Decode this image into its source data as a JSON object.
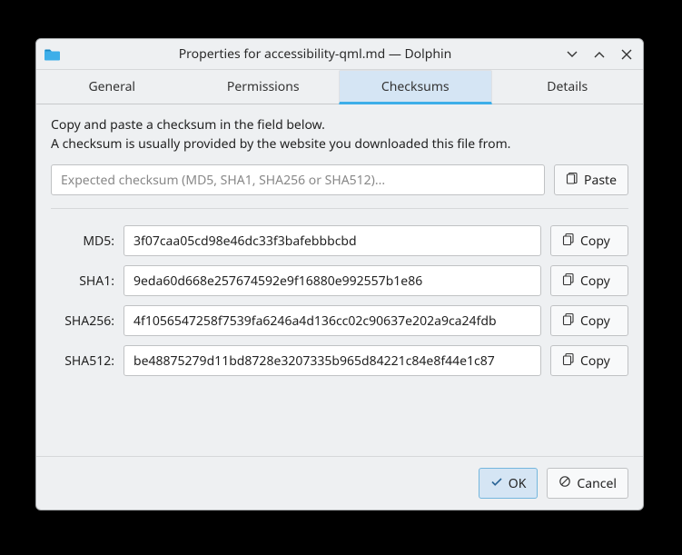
{
  "window": {
    "title": "Properties for accessibility-qml.md — Dolphin"
  },
  "tabs": [
    {
      "label": "General",
      "active": false
    },
    {
      "label": "Permissions",
      "active": false
    },
    {
      "label": "Checksums",
      "active": true
    },
    {
      "label": "Details",
      "active": false
    }
  ],
  "intro": {
    "line1": "Copy and paste a checksum in the field below.",
    "line2": "A checksum is usually provided by the website you downloaded this file from."
  },
  "expected": {
    "placeholder": "Expected checksum (MD5, SHA1, SHA256 or SHA512)...",
    "value": "",
    "paste_label": "Paste"
  },
  "rows": [
    {
      "label": "MD5:",
      "value": "3f07caa05cd98e46dc33f3bafebbbcbd",
      "copy_label": "Copy"
    },
    {
      "label": "SHA1:",
      "value": "9eda60d668e257674592e9f16880e992557b1e86",
      "copy_label": "Copy"
    },
    {
      "label": "SHA256:",
      "value": "4f1056547258f7539fa6246a4d136cc02c90637e202a9ca24fdb",
      "copy_label": "Copy"
    },
    {
      "label": "SHA512:",
      "value": "be48875279d11bd8728e3207335b965d84221c84e8f44e1c87",
      "copy_label": "Copy"
    }
  ],
  "footer": {
    "ok_label": "OK",
    "cancel_label": "Cancel"
  }
}
